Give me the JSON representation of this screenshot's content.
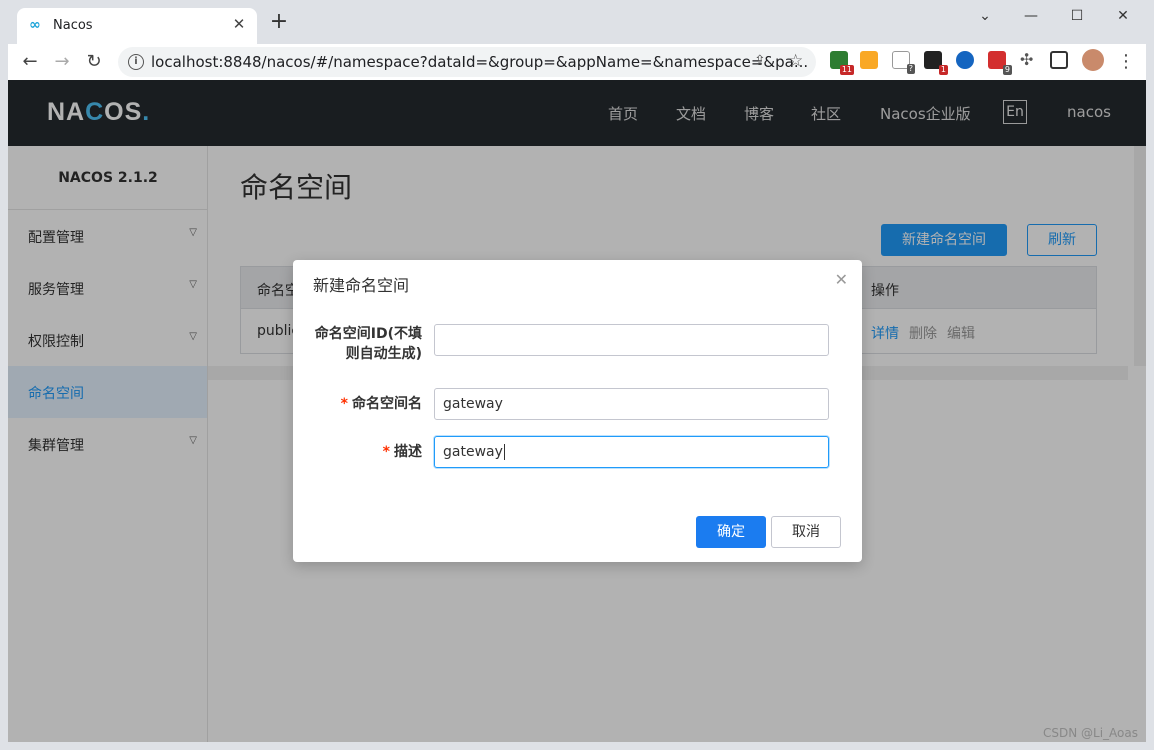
{
  "browser": {
    "tab_title": "Nacos",
    "url": "localhost:8848/nacos/#/namespace?dataId=&group=&appName=&namespace=&pa...",
    "extension_badges": [
      "11",
      "1",
      "9"
    ]
  },
  "nav": {
    "logo": "NACOS.",
    "items": [
      "首页",
      "文档",
      "博客",
      "社区",
      "Nacos企业版"
    ],
    "lang": "En",
    "user": "nacos"
  },
  "sidebar": {
    "version": "NACOS 2.1.2",
    "items": [
      {
        "label": "配置管理"
      },
      {
        "label": "服务管理"
      },
      {
        "label": "权限控制"
      },
      {
        "label": "命名空间"
      },
      {
        "label": "集群管理"
      }
    ]
  },
  "content": {
    "title": "命名空间",
    "new_button": "新建命名空间",
    "refresh_button": "刷新",
    "table": {
      "headers": [
        "命名空",
        "操作"
      ],
      "rows": [
        {
          "name": "public",
          "detail": "详情",
          "delete": "删除",
          "edit": "编辑"
        }
      ]
    }
  },
  "dialog": {
    "title": "新建命名空间",
    "fields": {
      "id_label": "命名空间ID(不填则自动生成)",
      "id_label_line1": "命名空间ID(不填",
      "id_label_line2": "则自动生成)",
      "id_value": "",
      "name_label": "命名空间名",
      "name_value": "gateway",
      "desc_label": "描述",
      "desc_value": "gateway"
    },
    "ok_button": "确定",
    "cancel_button": "取消"
  },
  "watermark": "CSDN @Li_Aoas",
  "colors": {
    "accent": "#209bfa",
    "header_bg": "#252a2f",
    "required": "#ff3000"
  }
}
